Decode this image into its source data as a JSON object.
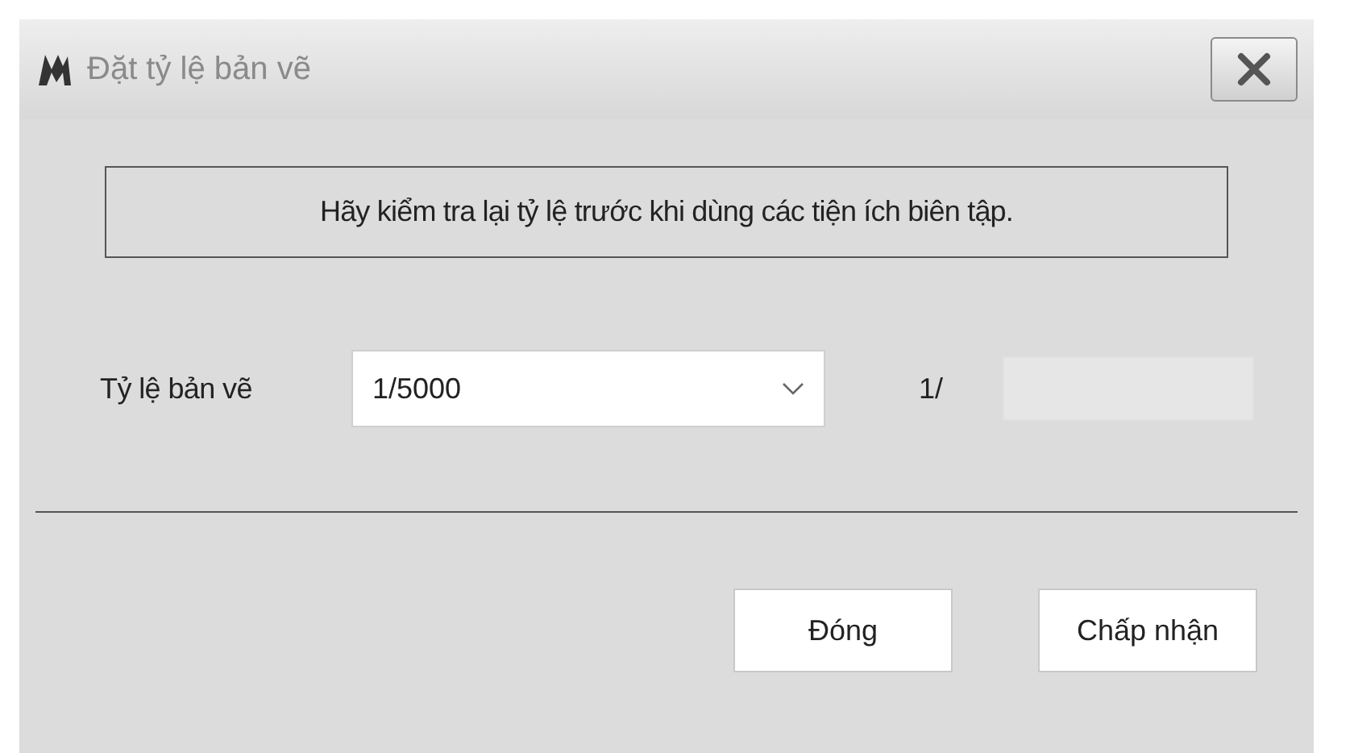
{
  "window": {
    "title": "Đặt tỷ lệ bản vẽ"
  },
  "message": "Hãy kiểm tra lại tỷ lệ trước khi dùng các tiện ích biên tập.",
  "scale": {
    "label": "Tỷ lệ bản vẽ",
    "value": "1/5000",
    "prefix": "1/",
    "custom_field": {
      "disabled": true
    }
  },
  "buttons": [
    {
      "label": "Đóng"
    },
    {
      "label": "Chấp nhận"
    }
  ]
}
